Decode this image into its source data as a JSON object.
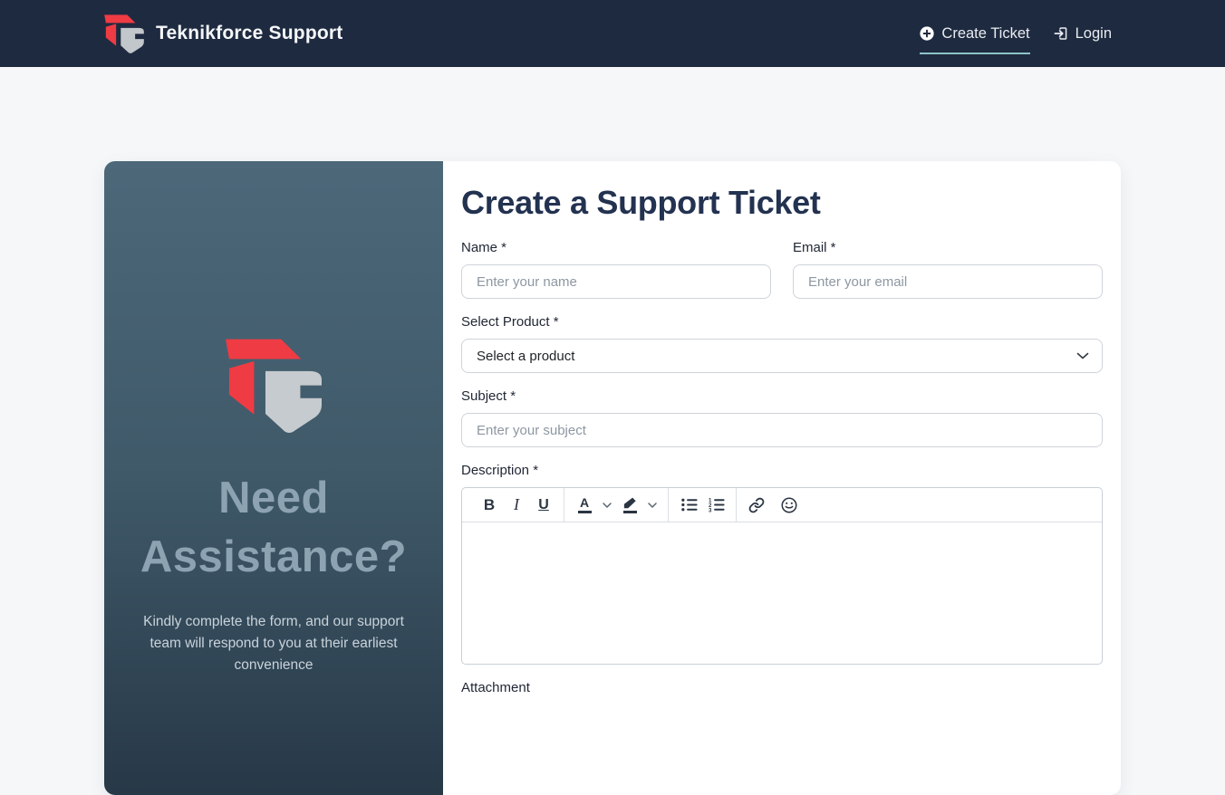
{
  "navbar": {
    "brand": "Teknikforce Support",
    "links": [
      {
        "label": "Create Ticket",
        "icon": "plus-circle-icon",
        "active": true
      },
      {
        "label": "Login",
        "icon": "login-icon",
        "active": false
      }
    ]
  },
  "left_panel": {
    "heading": "Need Assistance?",
    "message": "Kindly complete the form, and our support team will respond to you at their earliest convenience"
  },
  "form": {
    "title": "Create a Support Ticket",
    "name": {
      "label": "Name *",
      "placeholder": "Enter your name"
    },
    "email": {
      "label": "Email *",
      "placeholder": "Enter your email"
    },
    "product": {
      "label": "Select Product *",
      "selected": "Select a product"
    },
    "subject": {
      "label": "Subject *",
      "placeholder": "Enter your subject"
    },
    "description": {
      "label": "Description *"
    },
    "attachment": {
      "label": "Attachment"
    }
  },
  "editor": {
    "toolbar": {
      "bold": "B",
      "italic": "I",
      "underline": "U",
      "font_color": "A",
      "items": [
        "bold",
        "italic",
        "underline",
        "font-color",
        "highlight-color",
        "bullet-list",
        "numbered-list",
        "link",
        "emoji"
      ]
    },
    "content": ""
  },
  "colors": {
    "navbar_bg": "#1e2a40",
    "accent_underline": "#8cc3c6",
    "brand_red": "#ef3b43",
    "brand_gray": "#c2c7cb",
    "panel_gradient_top": "#4c6879",
    "panel_gradient_bottom": "#273847",
    "heading_text": "#233250",
    "page_bg": "#f5f7f9"
  }
}
